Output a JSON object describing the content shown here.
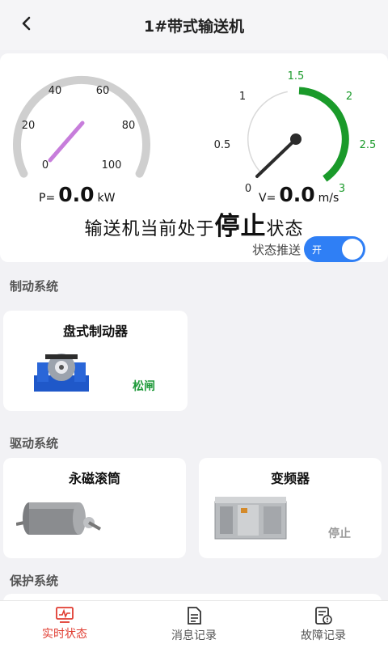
{
  "header": {
    "title": "1#带式输送机",
    "back_icon": "chevron-left-icon"
  },
  "power_gauge": {
    "ticks": [
      "0",
      "20",
      "40",
      "60",
      "80",
      "100"
    ],
    "min": 0,
    "max": 100,
    "value": 0.0,
    "prefix": "P=",
    "value_text": "0.0",
    "unit": "kW",
    "needle_color": "#c77ddb"
  },
  "speed_gauge": {
    "ticks": [
      "0",
      "0.5",
      "1",
      "1.5",
      "2",
      "2.5",
      "3"
    ],
    "min": 0,
    "max": 3,
    "value": 0.0,
    "prefix": "V=",
    "value_text": "0.0",
    "unit": "m/s",
    "accent_color": "#1a9a2a"
  },
  "status": {
    "prefix": "输送机当前处于",
    "state": "停止",
    "suffix": "状态"
  },
  "push": {
    "label": "状态推送",
    "toggle_text": "开",
    "on": true,
    "color": "#2f7ff5"
  },
  "sections": {
    "brake": {
      "title": "制动系统",
      "cards": [
        {
          "name": "盘式制动器",
          "state": "松闸",
          "state_color": "#1f9a3a"
        }
      ]
    },
    "drive": {
      "title": "驱动系统",
      "cards": [
        {
          "name": "永磁滚筒",
          "state": ""
        },
        {
          "name": "变频器",
          "state": "停止",
          "state_color": "#999999"
        }
      ]
    },
    "protection": {
      "title": "保护系统"
    }
  },
  "tabs": [
    {
      "label": "实时状态",
      "icon": "monitor-icon",
      "active": true
    },
    {
      "label": "消息记录",
      "icon": "document-icon",
      "active": false
    },
    {
      "label": "故障记录",
      "icon": "fault-log-icon",
      "active": false
    }
  ],
  "colors": {
    "active_tab": "#e03c31",
    "background": "#f2f2f5"
  }
}
